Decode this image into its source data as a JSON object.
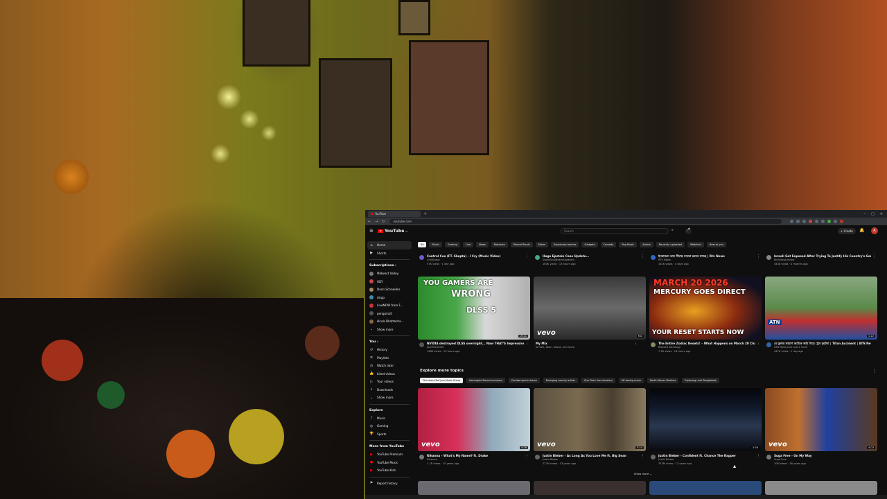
{
  "browser": {
    "tab_title": "YouTube",
    "url": "youtube.com"
  },
  "youtube": {
    "logo_text": "YouTube",
    "logo_country": "IN",
    "search_placeholder": "Search",
    "create_label": "+ Create",
    "avatar_letter": "A"
  },
  "chips": [
    "All",
    "Music",
    "Gaming",
    "Live",
    "News",
    "Podcasts",
    "Marvel Rivals",
    "Mixes",
    "Superhero movies",
    "Gadgets",
    "Comedy",
    "Pop Music",
    "Anime",
    "Recently uploaded",
    "Watched",
    "New to you"
  ],
  "sidebar": {
    "main": [
      {
        "label": "Home",
        "icon": "home-icon"
      },
      {
        "label": "Shorts",
        "icon": "shorts-icon"
      }
    ],
    "subscriptions_header": "Subscriptions",
    "subscriptions": [
      "Midwest Valley",
      "UDY",
      "Dean Schneider",
      "Airgo",
      "LiveNOW from F...",
      "penguinz0",
      "Hinds Bhattacha..."
    ],
    "show_more": "Show more",
    "you_header": "You",
    "you": [
      {
        "label": "History",
        "icon": "history-icon"
      },
      {
        "label": "Playlists",
        "icon": "playlist-icon"
      },
      {
        "label": "Watch later",
        "icon": "clock-icon"
      },
      {
        "label": "Liked videos",
        "icon": "like-icon"
      },
      {
        "label": "Your videos",
        "icon": "video-icon"
      },
      {
        "label": "Downloads",
        "icon": "download-icon"
      },
      {
        "label": "Show more",
        "icon": "chevron-down-icon"
      }
    ],
    "explore_header": "Explore",
    "explore": [
      {
        "label": "Music",
        "icon": "music-icon"
      },
      {
        "label": "Gaming",
        "icon": "gaming-icon"
      },
      {
        "label": "Sports",
        "icon": "trophy-icon"
      }
    ],
    "more_header": "More from YouTube",
    "more": [
      "YouTube Premium",
      "YouTube Music",
      "YouTube Kids"
    ],
    "report": "Report history"
  },
  "top_row": [
    {
      "title": "Central Cee (FT. Skepta) - I Cry (Music Video)",
      "channel": "ChillScope",
      "views": "57K views · 1 day ago"
    },
    {
      "title": "Huge Epstein Case Update...",
      "channel": "StoneSkullBeerySpeakers",
      "views": "160K views · 13 hours ago"
    },
    {
      "title": "ইসরায়েল তার সীমান্ত ব্যবস্থা করতে যাচ্ছে | Rtv News",
      "channel": "RTV News",
      "views": "162K views · 4 days ago"
    },
    {
      "title": "Israeli Got Exposed After Trying To Justify His Country's Genocide!",
      "channel": "MGVideoLimited",
      "views": "443K views · 4 months ago"
    }
  ],
  "feed_row": [
    {
      "title": "NVIDIA destroyed DLSS overnight... Now THAT'S Impressive!",
      "channel": "JazzTheGents",
      "views": "148K views · 19 hours ago",
      "duration": "19:21",
      "thumb_text_top": "YOU GAMERS ARE",
      "thumb_text_main": "WRONG",
      "thumb_text_sub": "DLSS 5",
      "badge": ""
    },
    {
      "title": "My Mix",
      "channel": "Jo Rain, Akon, Sasha, and more",
      "views": "",
      "duration": "Mix",
      "thumb_text_top": "",
      "thumb_text_main": "",
      "thumb_text_sub": "",
      "badge": "vevo"
    },
    {
      "title": "The Entire Zodiac Resets! – What Happens on March 20 Changes EVERYTHING!",
      "channel": "Blessed Astrology",
      "views": "7.3K views · 18 hours ago",
      "duration": "",
      "thumb_text_top": "MARCH 20 2026",
      "thumb_text_main": "MERCURY GOES DIRECT",
      "thumb_text_sub": "YOUR RESET STARTS NOW",
      "badge": ""
    },
    {
      "title": "বে তুলার কারণে আটকে জমি নিয়ে ট্রেন দুর্ঘটনা | Titan Accident | ATN News",
      "channel": "ATN News Live and 2 more",
      "views": "447K views · 1 day ago",
      "duration": "1:22",
      "thumb_text_top": "ATN",
      "thumb_text_main": "",
      "thumb_text_sub": "",
      "badge": ""
    }
  ],
  "explore_section": {
    "title": "Explore more topics",
    "topics": [
      "The Island Def Jam Music Group",
      "Aamorgold Marvel monsters",
      "Combat sports drama",
      "Emerging country artists",
      "One Piece live monsters",
      "UK boxing scene",
      "North African Muslims",
      "Exploring rural Bangladesh"
    ],
    "videos": [
      {
        "title": "Rihanna - What's My Name? ft. Drake",
        "channel": "Rihanna",
        "views": "1.1B views · 15 years ago",
        "duration": "4:26",
        "badge": "vevo"
      },
      {
        "title": "Justin Bieber - As Long As You Love Me ft. Big Sean",
        "channel": "Justin Bieber",
        "views": "227M views · 13 years ago",
        "duration": "5:24",
        "badge": "vevo"
      },
      {
        "title": "Justin Bieber - Confident ft. Chance The Rapper",
        "channel": "Justin Bieber",
        "views": "373M views · 12 years ago",
        "duration": "3:36",
        "badge": ""
      },
      {
        "title": "Suga Free - On My Way",
        "channel": "Suga Free",
        "views": "10M views · 16 years ago",
        "duration": "4:03",
        "badge": "vevo"
      }
    ],
    "show_more": "Show more"
  },
  "colors": {
    "accent": "#ff0000",
    "bg": "#0f0f0f",
    "chip": "#272727",
    "text": "#f1f1f1",
    "subtext": "#aaaaaa"
  }
}
